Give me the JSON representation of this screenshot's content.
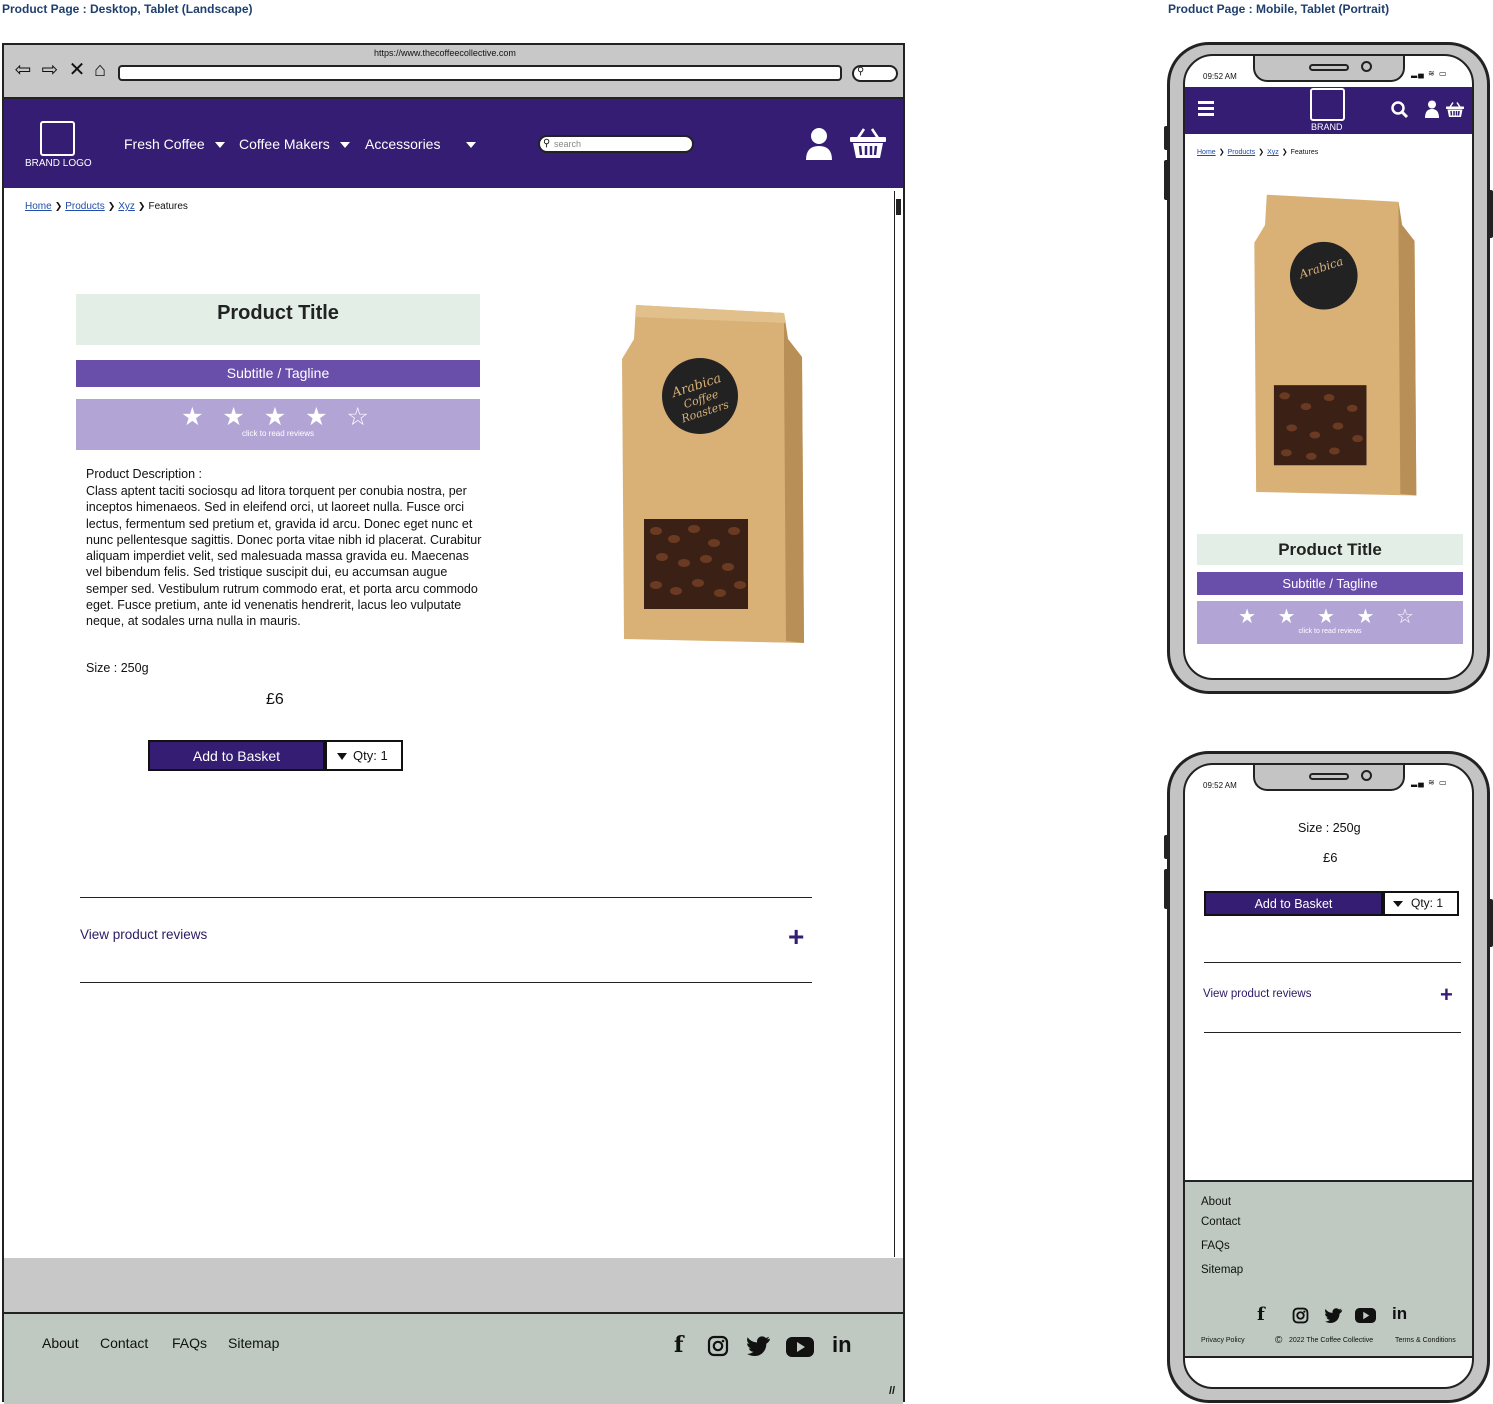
{
  "headings": {
    "desktop": "Product Page : Desktop, Tablet (Landscape)",
    "mobile": "Product Page : Mobile, Tablet (Portrait)"
  },
  "browser": {
    "url": "https://www.thecoffeecollective.com"
  },
  "nav": {
    "logo": "BRAND LOGO",
    "mobile_logo": "BRAND",
    "menu": [
      "Fresh Coffee",
      "Coffee Makers",
      "Accessories"
    ],
    "search_placeholder": "search"
  },
  "breadcrumb": {
    "home": "Home",
    "products": "Products",
    "xyz": "Xyz",
    "current": "Features"
  },
  "product": {
    "title": "Product Title",
    "subtitle": "Subtitle / Tagline",
    "rating": 4,
    "rating_max": 5,
    "stars": "★ ★ ★ ★ ☆",
    "rating_caption": "click to read reviews",
    "description_label": "Product Description :",
    "description": "Class aptent taciti sociosqu ad litora torquent per conubia nostra, per inceptos himenaeos. Sed in eleifend orci, ut laoreet nulla. Fusce orci lectus, fermentum sed pretium et, gravida id arcu. Donec eget nunc et nunc pellentesque sagittis. Donec porta vitae nibh id placerat. Curabitur aliquam imperdiet velit, sed malesuada massa gravida eu. Maecenas vel bibendum felis. Sed tristique suscipit dui, eu accumsan augue semper sed. Vestibulum rutrum commodo erat, et porta arcu commodo eget. Fusce pretium, ante id venenatis hendrerit, lacus leo vulputate neque, at sodales urna nulla in mauris.",
    "size": "Size : 250g",
    "price": "£6",
    "add_to_basket": "Add to Basket",
    "qty": "Qty: 1",
    "bag_logo": "Arabica Coffee Roasters"
  },
  "reviews": {
    "label": "View product reviews",
    "expand": "+"
  },
  "footer": {
    "links": [
      "About",
      "Contact",
      "FAQs",
      "Sitemap"
    ],
    "privacy": "Privacy Policy",
    "copyright": "2022 The Coffee Collective",
    "terms": "Terms & Conditions",
    "social_icons": [
      "facebook-icon",
      "instagram-icon",
      "twitter-icon",
      "youtube-icon",
      "linkedin-icon"
    ]
  },
  "mobile": {
    "time": "09:52 AM"
  },
  "colors": {
    "nav_purple": "#341d72",
    "subtitle_purple": "#6a4faa",
    "rating_lilac": "#b3a4d6",
    "title_mint": "#e3efe6",
    "footer_grey": "#bfc9c2",
    "link_blue": "#1f4da8"
  }
}
